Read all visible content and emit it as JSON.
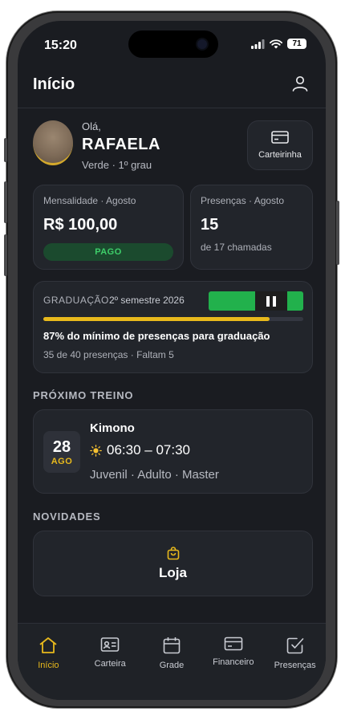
{
  "status": {
    "time": "15:20",
    "battery": "71"
  },
  "header": {
    "title": "Início"
  },
  "user": {
    "greeting": "Olá,",
    "name": "RAFAELA",
    "belt": "Verde · 1º grau"
  },
  "wallet_button": {
    "label": "Carteirinha"
  },
  "fee_card": {
    "label": "Mensalidade · Agosto",
    "amount": "R$ 100,00",
    "status": "PAGO"
  },
  "attendance_card": {
    "label": "Presenças · Agosto",
    "count": "15",
    "subtitle": "de 17 chamadas"
  },
  "graduation": {
    "label": "GRADUAÇÃO",
    "semester": "2º semestre 2026",
    "progress_percent": 87,
    "progress_text": "87% do mínimo de presenças para graduação",
    "detail": "35 de 40 presenças · Faltam 5"
  },
  "next_training": {
    "section_title": "PRÓXIMO TREINO",
    "day": "28",
    "month": "AGO",
    "title": "Kimono",
    "time": "06:30 – 07:30",
    "categories": "Juvenil · Adulto · Master"
  },
  "news": {
    "section_title": "NOVIDADES",
    "store_label": "Loja"
  },
  "nav": {
    "items": [
      {
        "label": "Início",
        "icon": "home-icon",
        "active": true
      },
      {
        "label": "Carteira",
        "icon": "id-card-icon",
        "active": false
      },
      {
        "label": "Grade",
        "icon": "calendar-icon",
        "active": false
      },
      {
        "label": "Financeiro",
        "icon": "credit-card-icon",
        "active": false
      },
      {
        "label": "Presenças",
        "icon": "checkbox-icon",
        "active": false
      }
    ]
  },
  "colors": {
    "accent": "#e8b91c",
    "paid": "#3ecf6a",
    "background": "#1a1c21",
    "card": "#22252b"
  }
}
